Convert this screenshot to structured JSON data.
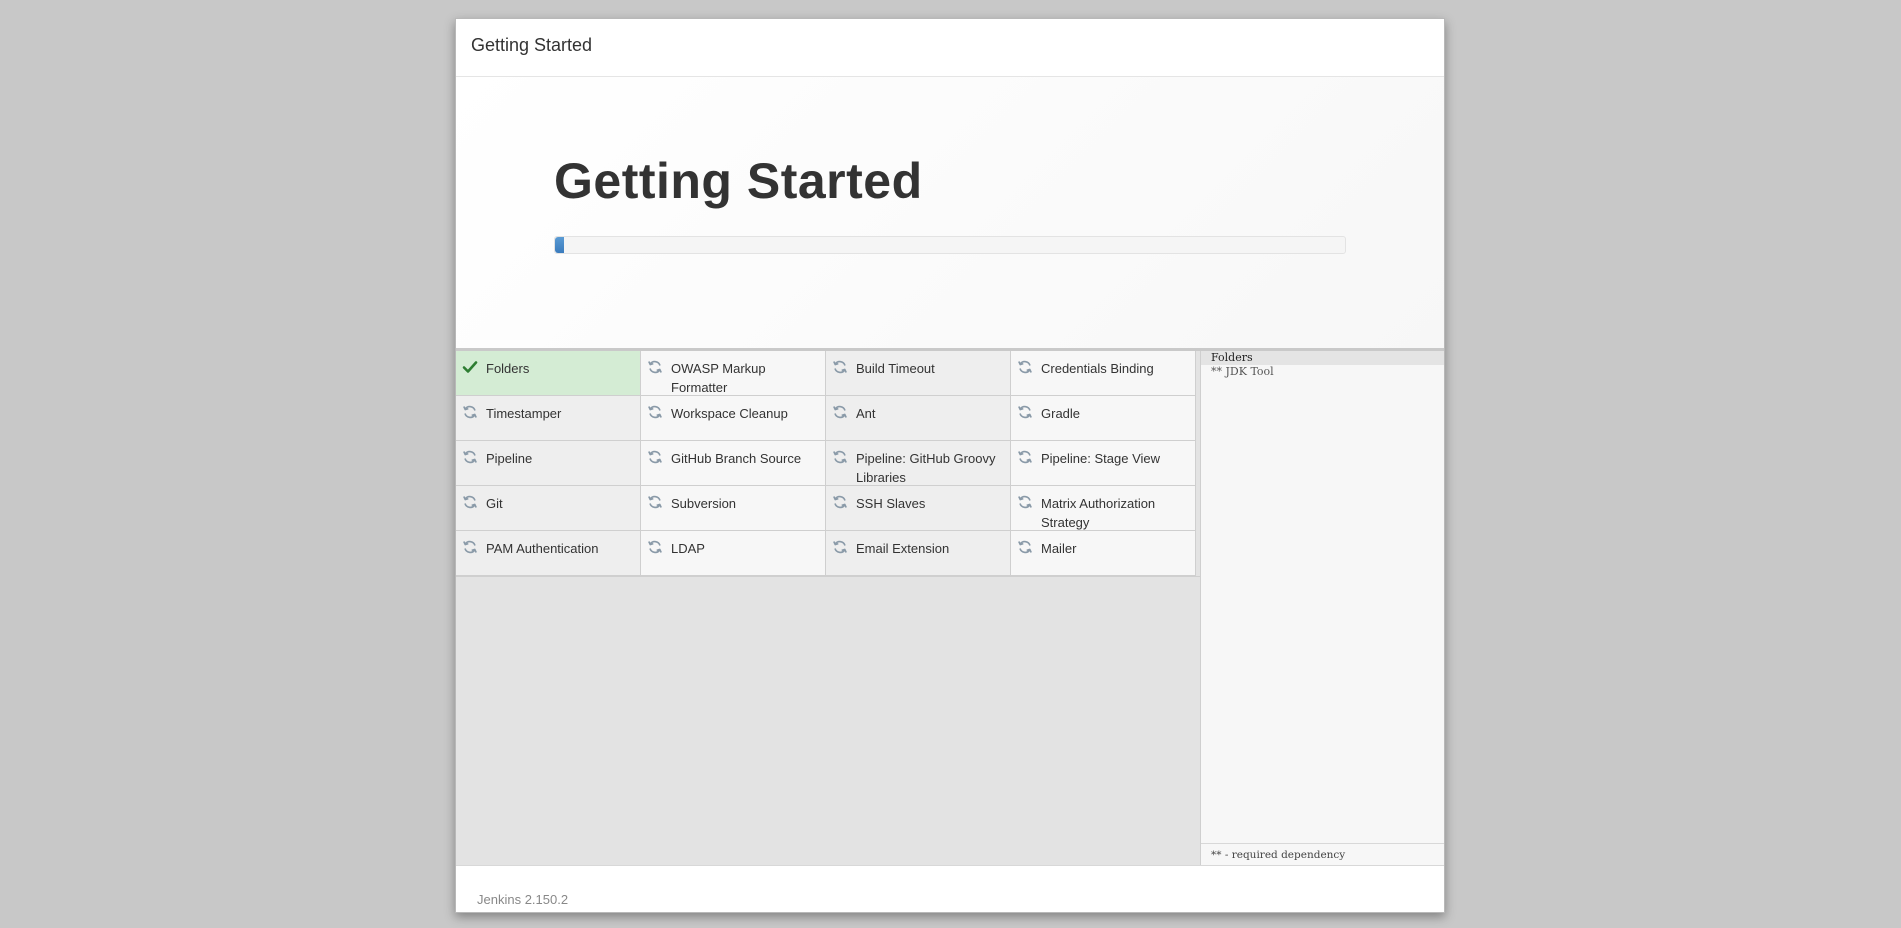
{
  "dialog": {
    "header_title": "Getting Started",
    "hero_title": "Getting Started",
    "progress_fraction": 0.012
  },
  "plugins": [
    {
      "name": "Folders",
      "status": "installed",
      "icon": "check-icon"
    },
    {
      "name": "OWASP Markup Formatter",
      "status": "pending",
      "icon": "refresh-icon"
    },
    {
      "name": "Build Timeout",
      "status": "pending",
      "icon": "refresh-icon"
    },
    {
      "name": "Credentials Binding",
      "status": "pending",
      "icon": "refresh-icon"
    },
    {
      "name": "Timestamper",
      "status": "pending",
      "icon": "refresh-icon"
    },
    {
      "name": "Workspace Cleanup",
      "status": "pending",
      "icon": "refresh-icon"
    },
    {
      "name": "Ant",
      "status": "pending",
      "icon": "refresh-icon"
    },
    {
      "name": "Gradle",
      "status": "pending",
      "icon": "refresh-icon"
    },
    {
      "name": "Pipeline",
      "status": "pending",
      "icon": "refresh-icon"
    },
    {
      "name": "GitHub Branch Source",
      "status": "pending",
      "icon": "refresh-icon"
    },
    {
      "name": "Pipeline: GitHub Groovy Libraries",
      "status": "pending",
      "icon": "refresh-icon"
    },
    {
      "name": "Pipeline: Stage View",
      "status": "pending",
      "icon": "refresh-icon"
    },
    {
      "name": "Git",
      "status": "pending",
      "icon": "refresh-icon"
    },
    {
      "name": "Subversion",
      "status": "pending",
      "icon": "refresh-icon"
    },
    {
      "name": "SSH Slaves",
      "status": "pending",
      "icon": "refresh-icon"
    },
    {
      "name": "Matrix Authorization Strategy",
      "status": "pending",
      "icon": "refresh-icon"
    },
    {
      "name": "PAM Authentication",
      "status": "pending",
      "icon": "refresh-icon"
    },
    {
      "name": "LDAP",
      "status": "pending",
      "icon": "refresh-icon"
    },
    {
      "name": "Email Extension",
      "status": "pending",
      "icon": "refresh-icon"
    },
    {
      "name": "Mailer",
      "status": "pending",
      "icon": "refresh-icon"
    }
  ],
  "log": {
    "lines": [
      "Folders",
      "** JDK Tool"
    ],
    "legend": "** - required dependency"
  },
  "footer": {
    "version": "Jenkins 2.150.2"
  },
  "colors": {
    "installed_bg": "#d4ecd4",
    "check": "#2e7d32",
    "pending_icon": "#8a9aa8",
    "progress": "#3a7bbd"
  }
}
